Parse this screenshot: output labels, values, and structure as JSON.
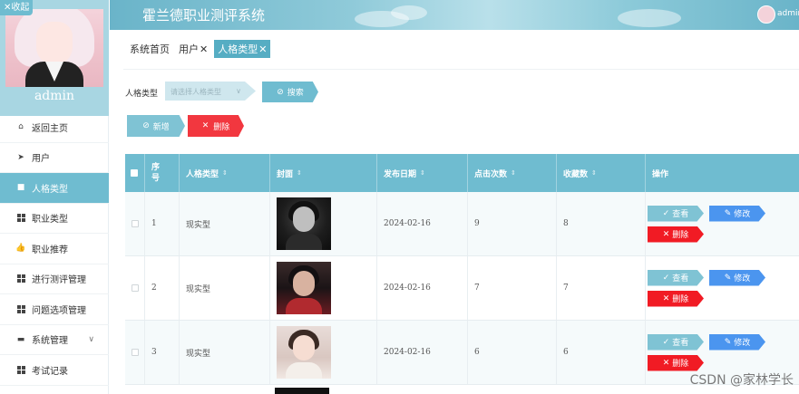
{
  "sidebar": {
    "collapse_label": "收起",
    "collapse_icon": "x-icon",
    "username": "admin",
    "items": [
      {
        "label": "返回主页",
        "icon": "home-icon"
      },
      {
        "label": "用户",
        "icon": "send-icon"
      },
      {
        "label": "人格类型",
        "icon": "doc-icon",
        "active": true
      },
      {
        "label": "职业类型",
        "icon": "grid-icon"
      },
      {
        "label": "职业推荐",
        "icon": "thumb-icon"
      },
      {
        "label": "进行测评管理",
        "icon": "grid-icon"
      },
      {
        "label": "问题选项管理",
        "icon": "grid-icon"
      },
      {
        "label": "系统管理",
        "icon": "chat-icon",
        "has_children": true
      },
      {
        "label": "考试记录",
        "icon": "grid-icon"
      }
    ]
  },
  "header": {
    "title": "霍兰德职业测评系统",
    "user": "admin"
  },
  "breadcrumbs": [
    {
      "label": "系统首页",
      "closable": false
    },
    {
      "label": "用户",
      "closable": true
    },
    {
      "label": "人格类型",
      "closable": true,
      "active": true
    }
  ],
  "search": {
    "label": "人格类型",
    "placeholder": "请选择人格类型",
    "button": "搜索"
  },
  "toolbar": {
    "add": "新增",
    "delete": "删除"
  },
  "table": {
    "columns": [
      "",
      "序号",
      "人格类型",
      "封面",
      "发布日期",
      "点击次数",
      "收藏数",
      "操作"
    ],
    "rows": [
      {
        "index": "1",
        "type": "现实型",
        "date": "2024-02-16",
        "clicks": "9",
        "favorites": "8",
        "cover": "dark"
      },
      {
        "index": "2",
        "type": "现实型",
        "date": "2024-02-16",
        "clicks": "7",
        "favorites": "7",
        "cover": "red"
      },
      {
        "index": "3",
        "type": "现实型",
        "date": "2024-02-16",
        "clicks": "6",
        "favorites": "6",
        "cover": "light"
      }
    ],
    "actions": {
      "view": "查看",
      "edit": "修改",
      "delete": "删除"
    }
  },
  "watermark": "CSDN @家林学长",
  "colors": {
    "accent": "#6fbcd0",
    "danger": "#f2373f",
    "edit": "#4b95ef"
  }
}
